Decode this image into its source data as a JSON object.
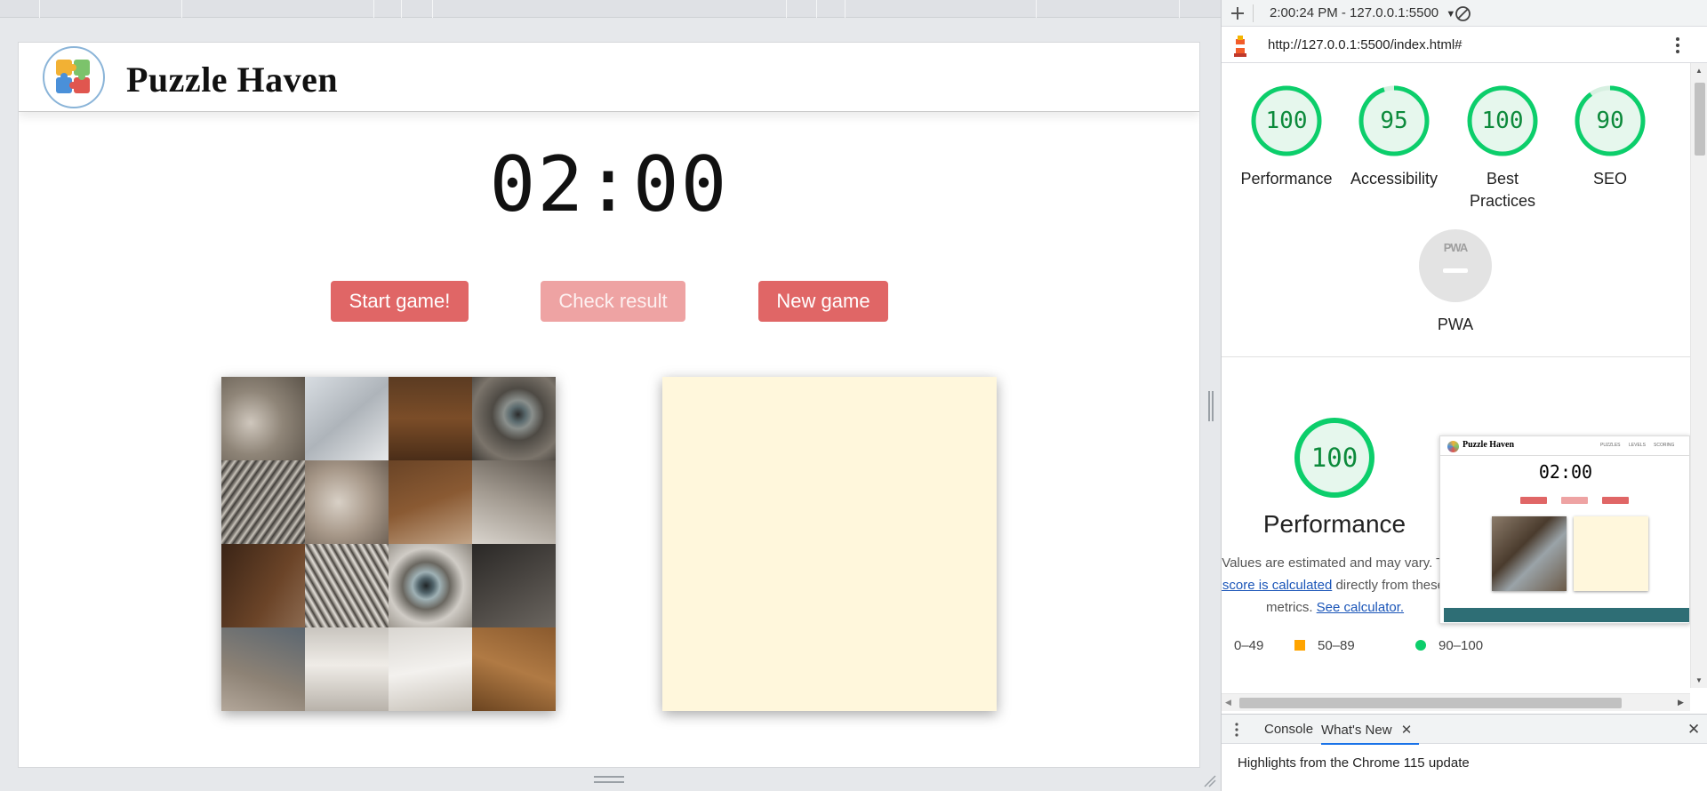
{
  "site": {
    "brand": "Puzzle Haven",
    "timer": "02:00",
    "buttons": {
      "start": "Start game!",
      "check": "Check result",
      "new": "New game"
    },
    "target_board_color": "#fff7dc",
    "button_color": "#e06666"
  },
  "devtools": {
    "toolbar": {
      "report_selector": "2:00:24 PM - 127.0.0.1:5500",
      "add_icon": "plus-icon",
      "clear_icon": "block-icon"
    },
    "url": "http://127.0.0.1:5500/index.html#",
    "scores": [
      {
        "label": "Performance",
        "value": "100"
      },
      {
        "label": "Accessibility",
        "value": "95"
      },
      {
        "label": "Best Practices",
        "value": "100"
      },
      {
        "label": "SEO",
        "value": "90"
      }
    ],
    "pwa_label": "PWA",
    "pwa_badge": "PWA",
    "detail": {
      "score": "100",
      "title": "Performance",
      "note_line1": "Values are estimated and may vary. The",
      "note_link": "performance score is calculated",
      "note_line2_rest": "directly from these",
      "note_line3_prefix": "metrics.",
      "note_link2": "See calculator."
    },
    "legend": [
      {
        "range": "0–49",
        "color": "#ff4e42"
      },
      {
        "range": "50–89",
        "color": "#ffa400"
      },
      {
        "range": "90–100",
        "color": "#0cce6b"
      }
    ],
    "preview": {
      "brand": "Puzzle Haven",
      "nav": [
        "PUZZLES",
        "LEVELS",
        "SCORING"
      ],
      "timer": "02:00"
    },
    "drawer": {
      "tabs": [
        "Console",
        "What's New"
      ],
      "active_tab": "What's New",
      "message": "Highlights from the Chrome 115 update"
    }
  }
}
